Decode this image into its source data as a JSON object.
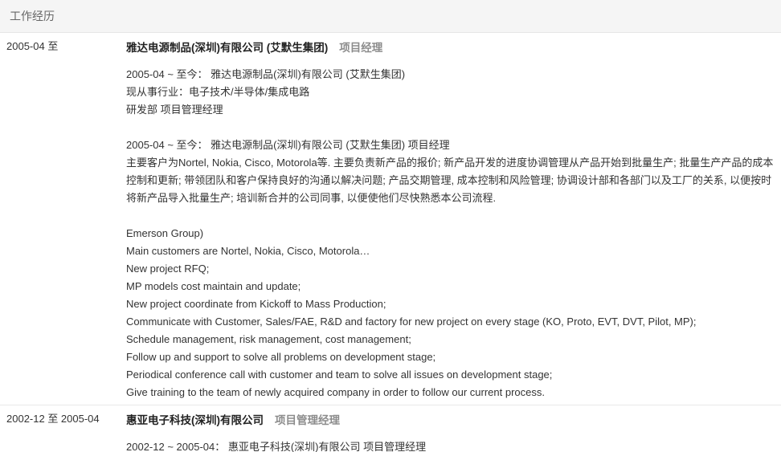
{
  "section": {
    "title": "工作经历"
  },
  "jobs": [
    {
      "period": "2005-04 至",
      "company": "雅达电源制品(深圳)有限公司 (艾默生集团)",
      "position": "项目经理",
      "lines": [
        "2005-04 ~ 至今： 雅达电源制品(深圳)有限公司 (艾默生集团)",
        "现从事行业：电子技术/半导体/集成电路",
        "研发部 项目管理经理",
        "",
        "2005-04 ~ 至今： 雅达电源制品(深圳)有限公司 (艾默生集团) 项目经理",
        "主要客户为Nortel, Nokia, Cisco, Motorola等. 主要负责新产品的报价; 新产品开发的进度协调管理从产品开始到批量生产; 批量生产产品的成本控制和更新; 带领团队和客户保持良好的沟通以解决问题; 产品交期管理, 成本控制和风险管理; 协调设计部和各部门以及工厂的关系, 以便按时将新产品导入批量生产; 培训新合并的公司同事, 以便使他们尽快熟悉本公司流程.",
        "",
        "Emerson Group)",
        "Main customers are Nortel, Nokia, Cisco, Motorola…",
        "New project RFQ;",
        "MP models cost maintain and update;",
        "New project coordinate from Kickoff to Mass Production;",
        "Communicate with Customer, Sales/FAE, R&D and factory for new project on every stage (KO, Proto, EVT, DVT, Pilot, MP);",
        "Schedule management, risk management, cost management;",
        "Follow up and support to solve all problems on development stage;",
        "Periodical conference call with customer and team to solve all issues on development stage;",
        "Give training to the team of newly acquired company in order to follow our current process."
      ]
    },
    {
      "period": "2002-12 至 2005-04",
      "company": "惠亚电子科技(深圳)有限公司",
      "position": "项目管理经理",
      "lines": [
        "2002-12 ~ 2005-04： 惠亚电子科技(深圳)有限公司 项目管理经理"
      ]
    }
  ]
}
